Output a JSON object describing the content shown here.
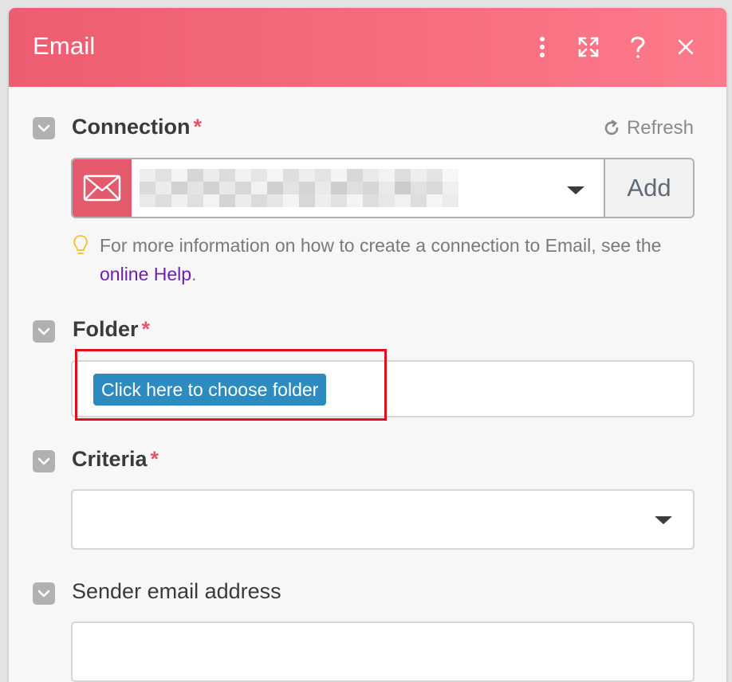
{
  "header": {
    "title": "Email",
    "icons": [
      "more-vertical-icon",
      "expand-icon",
      "help-icon",
      "close-icon"
    ],
    "gradient": [
      "#ee5c70",
      "#fc7a8b"
    ]
  },
  "connection": {
    "label": "Connection",
    "required_mark": "*",
    "refresh_label": "Refresh",
    "selected_value": "",
    "add_label": "Add",
    "hint": {
      "text_before": "For more information on how to create a connection to Email, see the",
      "link_text": "online Help",
      "text_after": "."
    }
  },
  "folder": {
    "label": "Folder",
    "required_mark": "*",
    "button_label": "Click here to choose folder"
  },
  "criteria": {
    "label": "Criteria",
    "required_mark": "*",
    "selected_value": ""
  },
  "sender": {
    "label": "Sender email address",
    "value": ""
  },
  "colors": {
    "accent": "#e35a6c",
    "required": "#e4576b",
    "link": "#6f1fb0",
    "button": "#2d8bc0",
    "highlight": "#e10f1c"
  }
}
